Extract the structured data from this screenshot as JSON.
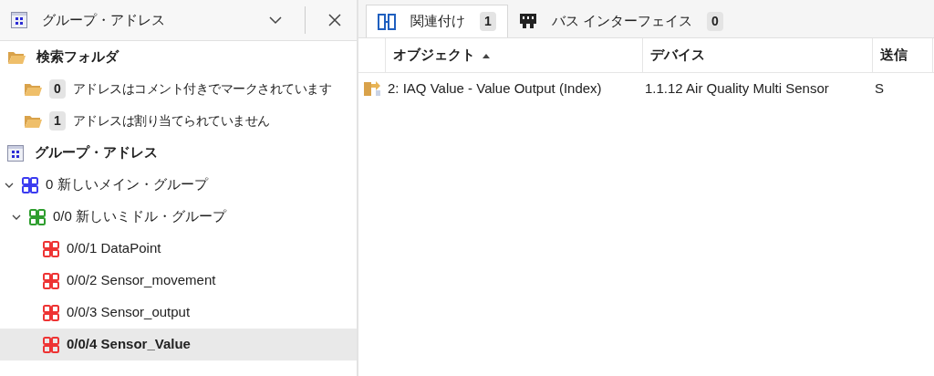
{
  "panel": {
    "title": "グループ・アドレス"
  },
  "search_folder": {
    "label": "検索フォルダ",
    "children": [
      {
        "count": "0",
        "label": "アドレスはコメント付きでマークされています"
      },
      {
        "count": "1",
        "label": "アドレスは割り当てられていません"
      }
    ]
  },
  "group_tree": {
    "label": "グループ・アドレス",
    "children": [
      {
        "kind": "main",
        "label": "0 新しいメイン・グループ",
        "expanded": true,
        "selected": false,
        "children": [
          {
            "kind": "middle",
            "label": "0/0 新しいミドル・グループ",
            "expanded": true,
            "selected": false,
            "children": [
              {
                "kind": "address",
                "label": "0/0/1 DataPoint",
                "selected": false
              },
              {
                "kind": "address",
                "label": "0/0/2 Sensor_movement",
                "selected": false
              },
              {
                "kind": "address",
                "label": "0/0/3 Sensor_output",
                "selected": false
              },
              {
                "kind": "address",
                "label": "0/0/4 Sensor_Value",
                "selected": true
              }
            ]
          }
        ]
      }
    ]
  },
  "tabs": [
    {
      "label": "関連付け",
      "count": "1",
      "selected": true,
      "kind": "links"
    },
    {
      "label": "バス インターフェイス",
      "count": "0",
      "selected": false,
      "kind": "bus"
    }
  ],
  "table": {
    "columns": [
      {
        "label": "オブジェクト",
        "sorted": true
      },
      {
        "label": "デバイス",
        "sorted": false
      },
      {
        "label": "送信",
        "sorted": false
      }
    ],
    "rows": [
      {
        "cells": [
          "2: IAQ Value - Value Output (Index)",
          "1.1.12 Air Quality Multi Sensor",
          "S"
        ]
      }
    ]
  }
}
